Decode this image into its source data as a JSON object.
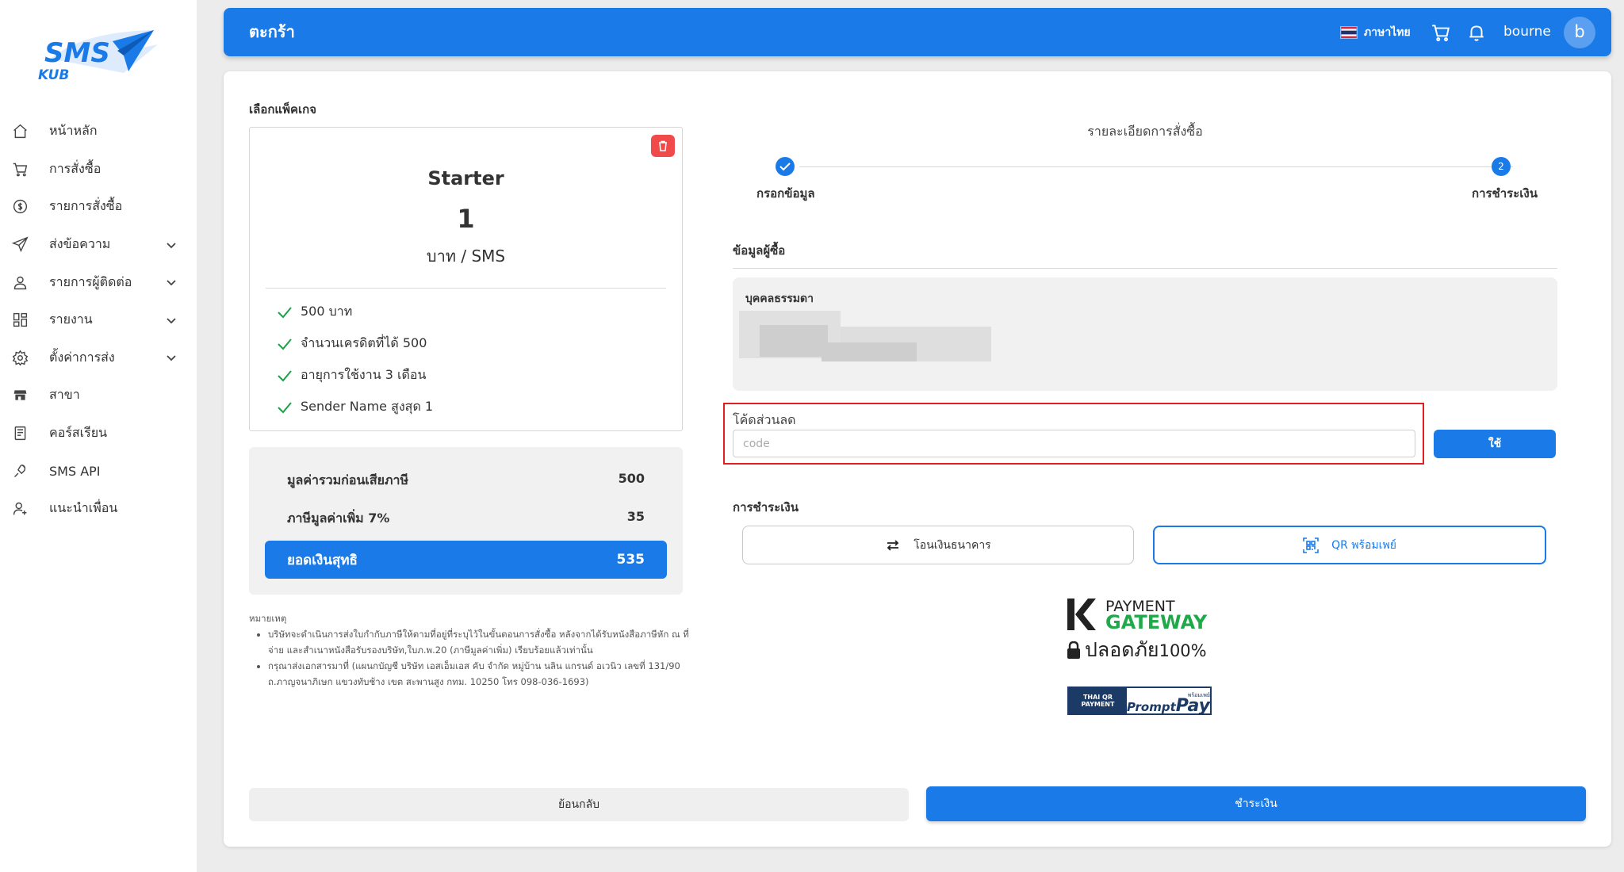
{
  "brand": {
    "logo_top": "SMS",
    "logo_bottom": "KUB",
    "accent": "#1a7ae8",
    "danger": "#f04a4a"
  },
  "sidebar": {
    "items": [
      {
        "label": "หน้าหลัก",
        "icon": "home-icon",
        "expandable": false
      },
      {
        "label": "การสั่งซื้อ",
        "icon": "cart-icon",
        "expandable": false
      },
      {
        "label": "รายการสั่งซื้อ",
        "icon": "coin-icon",
        "expandable": false
      },
      {
        "label": "ส่งข้อความ",
        "icon": "send-icon",
        "expandable": true
      },
      {
        "label": "รายการผู้ติดต่อ",
        "icon": "contact-icon",
        "expandable": true
      },
      {
        "label": "รายงาน",
        "icon": "report-icon",
        "expandable": true
      },
      {
        "label": "ตั้งค่าการส่ง",
        "icon": "settings-icon",
        "expandable": true
      },
      {
        "label": "สาขา",
        "icon": "branch-icon",
        "expandable": false
      },
      {
        "label": "คอร์สเรียน",
        "icon": "course-icon",
        "expandable": false
      },
      {
        "label": "SMS API",
        "icon": "api-icon",
        "expandable": false
      },
      {
        "label": "แนะนำเพื่อน",
        "icon": "referral-icon",
        "expandable": false
      }
    ]
  },
  "header": {
    "title": "ตะกร้า",
    "language": "ภาษาไทย",
    "username": "bourne",
    "avatar_letter": "b"
  },
  "package": {
    "section_label": "เลือกแพ็คเกจ",
    "name": "Starter",
    "price": "1",
    "unit": "บาท / SMS",
    "features": [
      "500 บาท",
      "จำนวนเครดิตที่ได้ 500",
      "อายุการใช้งาน 3 เดือน",
      "Sender Name สูงสุด 1"
    ]
  },
  "summary": {
    "subtotal_label": "มูลค่ารวมก่อนเสียภาษี",
    "subtotal_value": "500",
    "vat_label": "ภาษีมูลค่าเพิ่ม 7%",
    "vat_value": "35",
    "total_label": "ยอดเงินสุทธิ",
    "total_value": "535"
  },
  "notes": {
    "title": "หมายเหตุ",
    "items": [
      "บริษัทจะดำเนินการส่งใบกำกับภาษีให้ตามที่อยู่ที่ระบุไว้ในขั้นตอนการสั่งซื้อ หลังจากได้รับหนังสือภาษีหัก ณ ที่จ่าย และสำเนาหนังสือรับรองบริษัท,ใบภ.พ.20 (ภาษีมูลค่าเพิ่ม) เรียบร้อยแล้วเท่านั้น",
      "กรุณาส่งเอกสารมาที่ (แผนกบัญชี บริษัท เอสเอ็มเอส คับ จำกัด หมู่บ้าน นลิน แกรนด์ อเวนิว เลขที่ 131/90 ถ.ภาญจนาภิเษก แขวงทับช้าง เขต สะพานสูง กทม. 10250 โทร 098-036-1693)"
    ]
  },
  "order": {
    "title": "รายละเอียดการสั่งซื้อ",
    "steps": [
      {
        "label": "กรอกข้อมูล",
        "status": "done"
      },
      {
        "label": "การชำระเงิน",
        "number": "2",
        "status": "active"
      }
    ],
    "buyer_section": "ข้อมูลผู้ซื้อ",
    "buyer_type": "บุคคลธรรมดา",
    "discount_label": "โค้ดส่วนลด",
    "discount_placeholder": "code",
    "discount_value": "",
    "apply_label": "ใช้",
    "payment_section": "การชำระเงิน",
    "payment_methods": [
      {
        "label": "โอนเงินธนาคาร",
        "icon": "transfer-icon",
        "selected": false
      },
      {
        "label": "QR พร้อมเพย์",
        "icon": "qr-icon",
        "selected": true
      }
    ],
    "gateway_line1": "PAYMENT",
    "gateway_line2": "GATEWAY",
    "safe_text": "ปลอดภัย",
    "safe_percent": "100%",
    "qr_badge_left_1": "THAI QR",
    "qr_badge_left_2": "PAYMENT",
    "qr_badge_right_small": "พร้อมเพย์",
    "qr_badge_right_a": "Prompt",
    "qr_badge_right_b": "Pay"
  },
  "actions": {
    "back_label": "ย้อนกลับ",
    "pay_label": "ชำระเงิน"
  }
}
